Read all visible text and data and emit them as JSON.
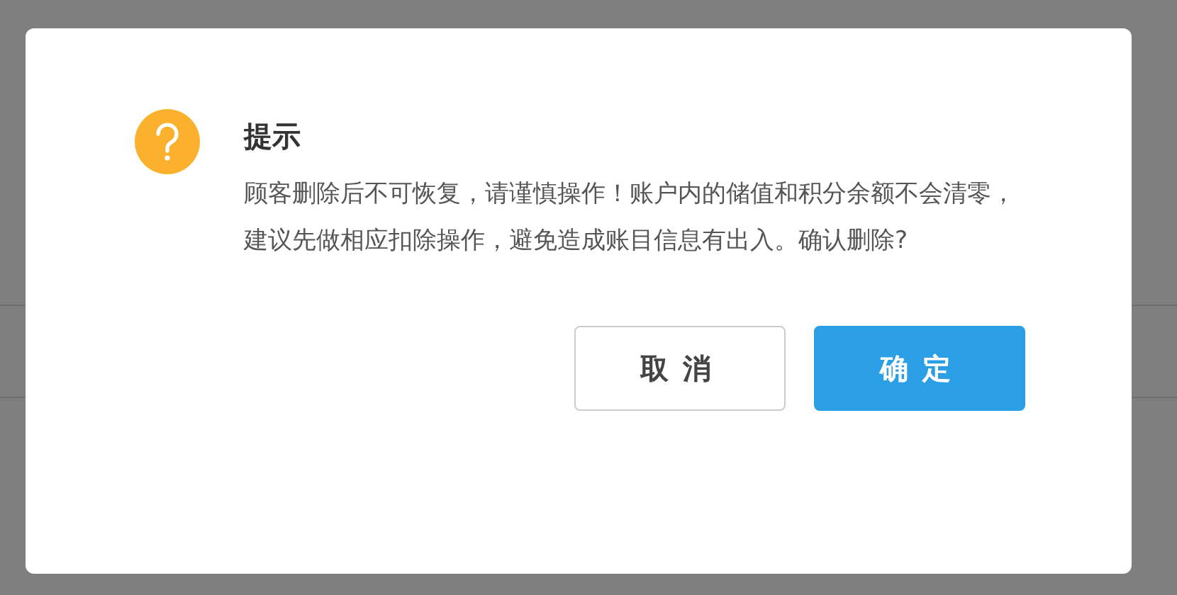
{
  "dialog": {
    "title": "提示",
    "message": "顾客删除后不可恢复，请谨慎操作！账户内的储值和积分余额不会清零，建议先做相应扣除操作，避免造成账目信息有出入。确认删除?",
    "buttons": [
      {
        "label": "取消",
        "kind": "secondary"
      },
      {
        "label": "确定",
        "kind": "primary"
      }
    ]
  }
}
